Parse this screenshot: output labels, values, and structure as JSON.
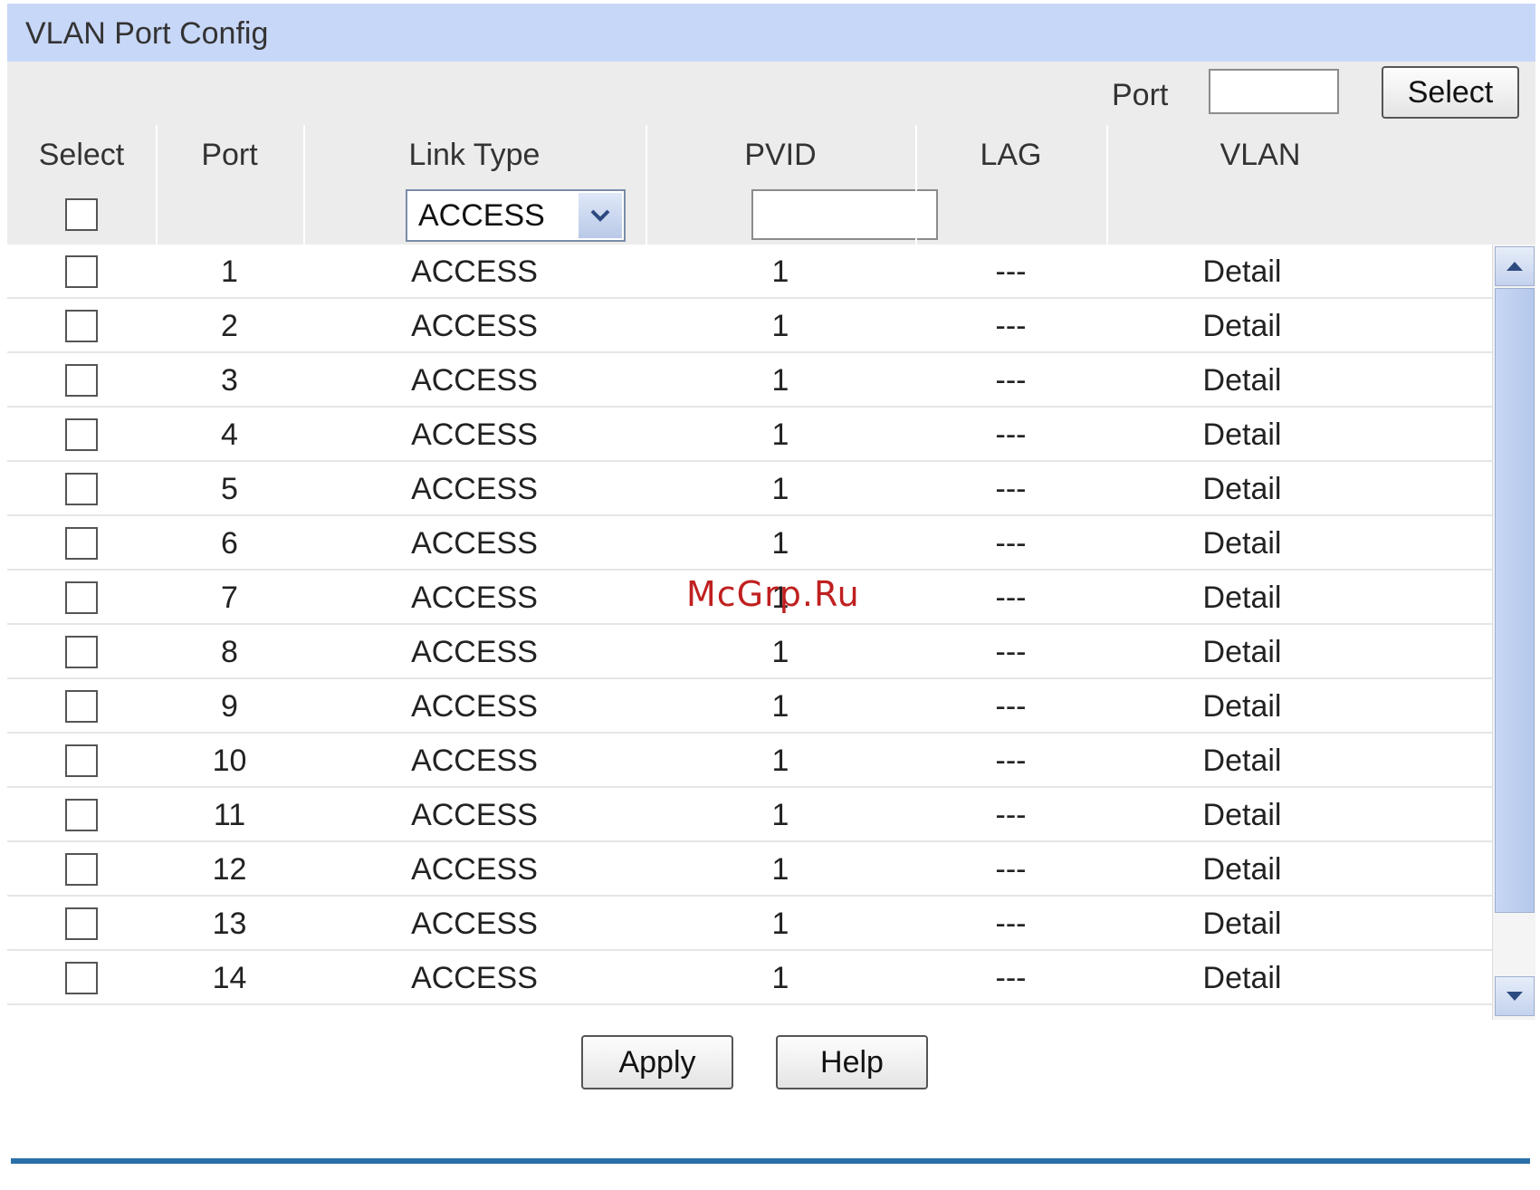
{
  "title": "VLAN Port Config",
  "search": {
    "port_label": "Port",
    "port_value": "",
    "select_label": "Select"
  },
  "columns": [
    "Select",
    "Port",
    "Link Type",
    "PVID",
    "LAG",
    "VLAN"
  ],
  "filter": {
    "link_type": "ACCESS",
    "pvid": ""
  },
  "rows": [
    {
      "port": "1",
      "link_type": "ACCESS",
      "pvid": "1",
      "lag": "---",
      "vlan": "Detail"
    },
    {
      "port": "2",
      "link_type": "ACCESS",
      "pvid": "1",
      "lag": "---",
      "vlan": "Detail"
    },
    {
      "port": "3",
      "link_type": "ACCESS",
      "pvid": "1",
      "lag": "---",
      "vlan": "Detail"
    },
    {
      "port": "4",
      "link_type": "ACCESS",
      "pvid": "1",
      "lag": "---",
      "vlan": "Detail"
    },
    {
      "port": "5",
      "link_type": "ACCESS",
      "pvid": "1",
      "lag": "---",
      "vlan": "Detail"
    },
    {
      "port": "6",
      "link_type": "ACCESS",
      "pvid": "1",
      "lag": "---",
      "vlan": "Detail"
    },
    {
      "port": "7",
      "link_type": "ACCESS",
      "pvid": "1",
      "lag": "---",
      "vlan": "Detail"
    },
    {
      "port": "8",
      "link_type": "ACCESS",
      "pvid": "1",
      "lag": "---",
      "vlan": "Detail"
    },
    {
      "port": "9",
      "link_type": "ACCESS",
      "pvid": "1",
      "lag": "---",
      "vlan": "Detail"
    },
    {
      "port": "10",
      "link_type": "ACCESS",
      "pvid": "1",
      "lag": "---",
      "vlan": "Detail"
    },
    {
      "port": "11",
      "link_type": "ACCESS",
      "pvid": "1",
      "lag": "---",
      "vlan": "Detail"
    },
    {
      "port": "12",
      "link_type": "ACCESS",
      "pvid": "1",
      "lag": "---",
      "vlan": "Detail"
    },
    {
      "port": "13",
      "link_type": "ACCESS",
      "pvid": "1",
      "lag": "---",
      "vlan": "Detail"
    },
    {
      "port": "14",
      "link_type": "ACCESS",
      "pvid": "1",
      "lag": "---",
      "vlan": "Detail"
    }
  ],
  "buttons": {
    "apply": "Apply",
    "help": "Help"
  },
  "watermark": "McGrp.Ru",
  "colors": {
    "title_bar": "#c7d7f7",
    "link": "#2a64d8",
    "rule": "#2a6fa8"
  }
}
